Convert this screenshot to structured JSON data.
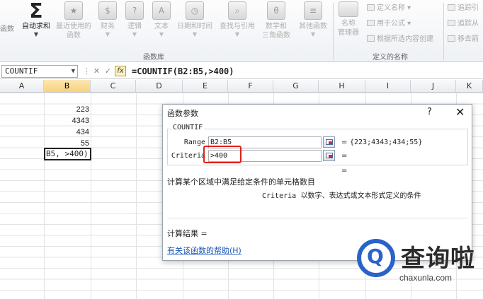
{
  "ribbon": {
    "cut_left_label": "函数",
    "buttons": [
      {
        "label": "自动求和",
        "icon": "Σ",
        "active": true
      },
      {
        "label": "最近使用的",
        "label2": "函数",
        "icon": "★"
      },
      {
        "label": "财务",
        "icon": "$"
      },
      {
        "label": "逻辑",
        "icon": "?"
      },
      {
        "label": "文本",
        "icon": "A"
      },
      {
        "label": "日期和时间",
        "icon": "◷"
      },
      {
        "label": "查找与引用",
        "icon": "⌕"
      },
      {
        "label": "数学和",
        "label2": "三角函数",
        "icon": "θ"
      },
      {
        "label": "其他函数",
        "icon": "≡"
      }
    ],
    "group_library_caption": "函数库",
    "name_manager": {
      "label": "名称",
      "label2": "管理器"
    },
    "defined_names": [
      "定义名称",
      "用于公式",
      "根据所选内容创建"
    ],
    "group_defined_caption": "定义的名称",
    "audit_items": [
      "追踪引",
      "追踪从",
      "移去箭"
    ]
  },
  "formula_bar": {
    "name_box": "COUNTIF",
    "formula": "=COUNTIF(B2:B5,>400)",
    "cancel": "✕",
    "enter": "✓",
    "fx": "fx"
  },
  "grid": {
    "columns": [
      "A",
      "B",
      "C",
      "D",
      "E",
      "F",
      "G",
      "H",
      "I",
      "J",
      "K"
    ],
    "cells": [
      {
        "value": "223"
      },
      {
        "value": "4343"
      },
      {
        "value": "434"
      },
      {
        "value": "55"
      }
    ],
    "active_cell_text": "B5, >400)"
  },
  "dialog": {
    "title": "函数参数",
    "help": "?",
    "close": "✕",
    "function_name": "COUNTIF",
    "args": [
      {
        "label": "Range",
        "value": "B2:B5",
        "result": "{223;4343;434;55}"
      },
      {
        "label": "Criteria",
        "value": ">400",
        "result": ""
      }
    ],
    "equals": "=",
    "description": "计算某个区域中满足给定条件的单元格数目",
    "arg_desc_name": "Criteria",
    "arg_desc_text": "以数字、表达式或文本形式定义的条件",
    "result_label": "计算结果 =",
    "help_link": "有关该函数的帮助(H)"
  },
  "watermark": {
    "text": "查询啦",
    "url": "chaxunla.com"
  },
  "colors": {
    "highlight": "#e0201a",
    "link": "#1d58b8",
    "selected_header": "#f8d27a",
    "brand_blue": "#2a63c8"
  }
}
